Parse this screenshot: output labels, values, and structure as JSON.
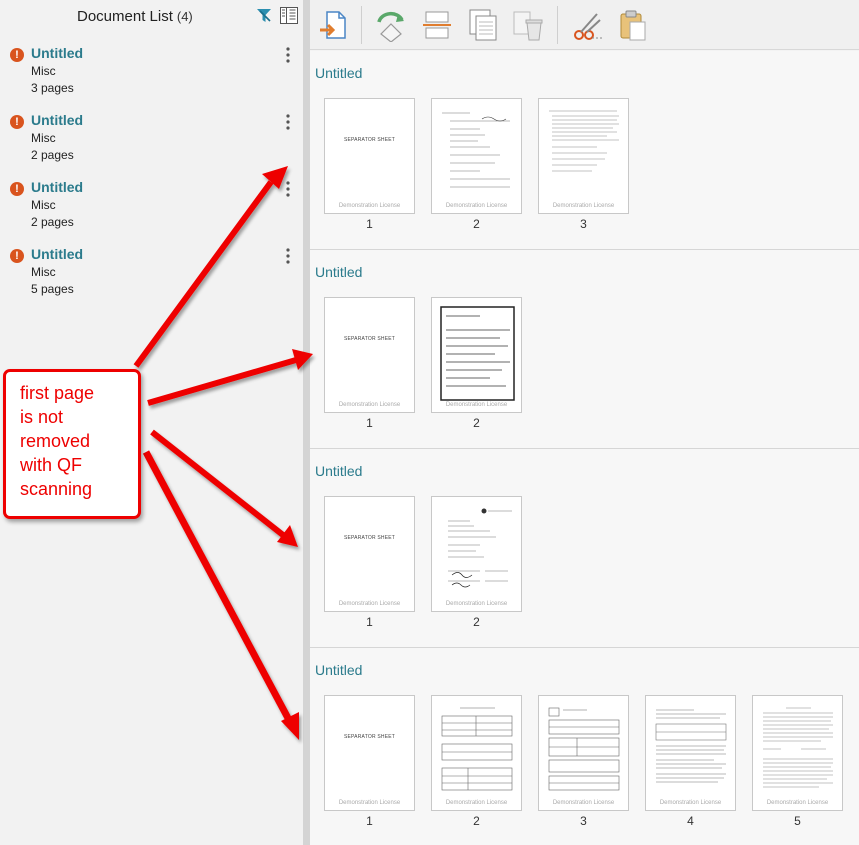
{
  "left_panel": {
    "title": "Document List",
    "count": "(4)",
    "documents": [
      {
        "name": "Untitled",
        "category": "Misc",
        "pages": "3 pages"
      },
      {
        "name": "Untitled",
        "category": "Misc",
        "pages": "2 pages"
      },
      {
        "name": "Untitled",
        "category": "Misc",
        "pages": "2 pages"
      },
      {
        "name": "Untitled",
        "category": "Misc",
        "pages": "5 pages"
      }
    ],
    "alert_glyph": "!",
    "menu_glyph": "⋮"
  },
  "toolbar": {
    "icons": [
      "export-document-icon",
      "rotate-page-icon",
      "split-page-icon",
      "copy-pages-icon",
      "delete-page-icon",
      "cut-icon",
      "paste-icon"
    ]
  },
  "sections": [
    {
      "title": "Untitled",
      "pages": [
        "1",
        "2",
        "3"
      ]
    },
    {
      "title": "Untitled",
      "pages": [
        "1",
        "2"
      ]
    },
    {
      "title": "Untitled",
      "pages": [
        "1",
        "2"
      ]
    },
    {
      "title": "Untitled",
      "pages": [
        "1",
        "2",
        "3",
        "4",
        "5"
      ]
    }
  ],
  "thumb": {
    "separator_text": "SEPARATOR SHEET",
    "license_text": "Demonstration License",
    "employee_form_title": "EMPLOYEE INFORMATION"
  },
  "annotation": {
    "lines": [
      "first page",
      "is not",
      "removed",
      "with QF",
      "scanning"
    ],
    "color": "#e00000"
  },
  "colors": {
    "accent": "#2b7b8c",
    "alert": "#d9541e",
    "annotation": "#e00000"
  }
}
